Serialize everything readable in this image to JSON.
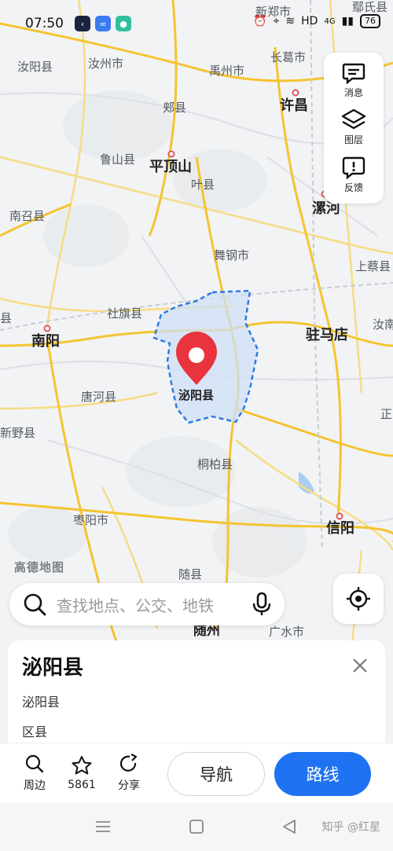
{
  "status_bar": {
    "time": "07:50",
    "network": "HD",
    "signal": "4G",
    "battery": "76"
  },
  "map": {
    "brand": "高德地图",
    "selected_place": "泌阳县",
    "colors": {
      "highlight_border": "#2f7be0",
      "highlight_fill": "#cfe0f6",
      "pin": "#e9343d",
      "highway": "#f4c430"
    },
    "labels": [
      {
        "id": "xinzheng",
        "text": "新郑市",
        "size": "small"
      },
      {
        "id": "lushi",
        "text": "鄢氏县",
        "size": "small"
      },
      {
        "id": "biyang_w",
        "text": "汝阳县",
        "size": "small"
      },
      {
        "id": "ruzhou",
        "text": "汝州市",
        "size": "small"
      },
      {
        "id": "yuzhou",
        "text": "禹州市",
        "size": "small"
      },
      {
        "id": "changge",
        "text": "长葛市",
        "size": "small"
      },
      {
        "id": "jiaxian",
        "text": "郏县",
        "size": "small"
      },
      {
        "id": "xuchang",
        "text": "许昌",
        "size": "city"
      },
      {
        "id": "lushan",
        "text": "鲁山县",
        "size": "small"
      },
      {
        "id": "pingdingshan",
        "text": "平顶山",
        "size": "city"
      },
      {
        "id": "yexian",
        "text": "叶县",
        "size": "small"
      },
      {
        "id": "nanzhao",
        "text": "南召县",
        "size": "small"
      },
      {
        "id": "luohe",
        "text": "漯河",
        "size": "city"
      },
      {
        "id": "wugang",
        "text": "舞钢市",
        "size": "small"
      },
      {
        "id": "shangcai",
        "text": "上蔡县",
        "size": "small"
      },
      {
        "id": "sheqi",
        "text": "社旗县",
        "size": "small"
      },
      {
        "id": "nanyang",
        "text": "南阳",
        "size": "city"
      },
      {
        "id": "zhumadian",
        "text": "驻马店",
        "size": "city"
      },
      {
        "id": "runan",
        "text": "汝南",
        "size": "small"
      },
      {
        "id": "tanghe",
        "text": "唐河县",
        "size": "small"
      },
      {
        "id": "biyang",
        "text": "泌阳县",
        "size": "pin"
      },
      {
        "id": "zheng",
        "text": "正",
        "size": "small"
      },
      {
        "id": "xinye",
        "text": "新野县",
        "size": "small"
      },
      {
        "id": "tongbai",
        "text": "桐柏县",
        "size": "small"
      },
      {
        "id": "zaoyang",
        "text": "枣阳市",
        "size": "small"
      },
      {
        "id": "xinyang",
        "text": "信阳",
        "size": "city"
      },
      {
        "id": "suixian",
        "text": "随县",
        "size": "small"
      },
      {
        "id": "suizhou",
        "text": "随州",
        "size": "city"
      },
      {
        "id": "guangshui",
        "text": "广水市",
        "size": "small"
      },
      {
        "id": "xian_left",
        "text": "县",
        "size": "small"
      }
    ]
  },
  "side_panel": {
    "messages_label": "消息",
    "layers_label": "图层",
    "feedback_label": "反馈"
  },
  "search": {
    "placeholder": "查找地点、公交、地铁"
  },
  "place_card": {
    "title": "泌阳县",
    "subtitle": "泌阳县",
    "category": "区县"
  },
  "actions": {
    "nearby_label": "周边",
    "favorite_count": "5861",
    "share_label": "分享",
    "navigate_label": "导航",
    "route_label": "路线"
  },
  "watermark": "知乎 @红星"
}
